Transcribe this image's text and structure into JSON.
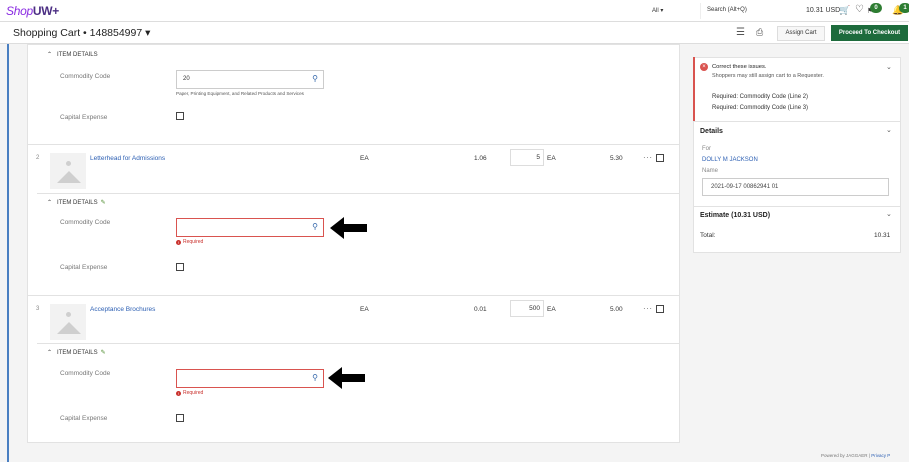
{
  "topbar": {
    "logo_shop": "Shop",
    "logo_uw": "UW+",
    "filter_label": "All ▾",
    "search_placeholder": "Search (Alt+Q)",
    "cart_amount": "10.31 USD",
    "badge_messages": "0",
    "badge_notifications": "1"
  },
  "header": {
    "cart_title": "Shopping Cart  •  148854997  ▾",
    "assign_label": "Assign Cart",
    "checkout_label": "Proceed To Checkout"
  },
  "line1": {
    "section_label": "ITEM DETAILS",
    "commodity_label": "Commodity Code",
    "commodity_value": "20",
    "commodity_desc": "Paper, Printing Equipment, and Related Products and Services",
    "capital_label": "Capital Expense"
  },
  "line2": {
    "num": "2",
    "name": "Letterhead for Admissions",
    "uom": "EA",
    "price": "1.06",
    "qty": "5",
    "qty_uom": "EA",
    "ext": "5.30",
    "more": "···",
    "section_label": "ITEM DETAILS",
    "commodity_label": "Commodity Code",
    "required": "Required",
    "capital_label": "Capital Expense"
  },
  "line3": {
    "num": "3",
    "name": "Acceptance Brochures",
    "uom": "EA",
    "price": "0.01",
    "qty": "500",
    "qty_uom": "EA",
    "ext": "5.00",
    "more": "···",
    "section_label": "ITEM DETAILS",
    "commodity_label": "Commodity Code",
    "required": "Required",
    "capital_label": "Capital Expense"
  },
  "panel": {
    "issue_title": "Correct these issues.",
    "issue_sub": "Shoppers may still assign cart to a Requester.",
    "issue_req1": "Required: Commodity Code (Line 2)",
    "issue_req2": "Required: Commodity Code (Line 3)",
    "details_head": "Details",
    "for_label": "For",
    "for_value": "DOLLY M JACKSON",
    "name_label": "Name",
    "name_value": "2021-09-17 00862941 01",
    "estimate_head": "Estimate (10.31 USD)",
    "total_label": "Total:",
    "total_value": "10.31"
  },
  "footer": {
    "powered": "Powered by JAGGAER | ",
    "privacy": "Privacy P"
  },
  "colors": {
    "brand_purple": "#4b2e83",
    "checkout_green": "#1d6b3c",
    "error_red": "#d9534f",
    "link_blue": "#2c5fb3"
  },
  "icons": [
    "search-icon",
    "cart-icon",
    "heart-icon",
    "flag-icon",
    "bell-icon",
    "menu-icon",
    "print-icon",
    "chevron-down-icon",
    "pencil-icon",
    "image-placeholder-icon",
    "error-icon",
    "arrow-left-icon"
  ]
}
